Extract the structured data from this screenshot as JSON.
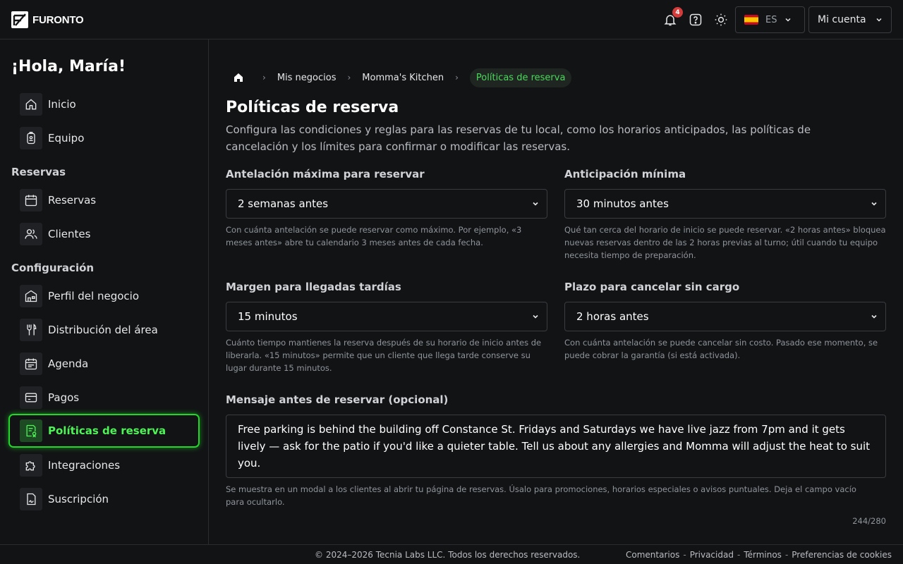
{
  "header": {
    "brand": "FURONTO",
    "notifications_count": "4",
    "language": "ES",
    "account_label": "Mi cuenta"
  },
  "sidebar": {
    "greeting": "¡Hola, María!",
    "items_top": [
      {
        "label": "Inicio",
        "icon": "home-icon"
      },
      {
        "label": "Equipo",
        "icon": "badge-icon"
      }
    ],
    "section_reservas": "Reservas",
    "items_reservas": [
      {
        "label": "Reservas",
        "icon": "calendar-icon"
      },
      {
        "label": "Clientes",
        "icon": "users-icon"
      }
    ],
    "section_config": "Configuración",
    "items_config": [
      {
        "label": "Perfil del negocio",
        "icon": "store-icon"
      },
      {
        "label": "Distribución del área",
        "icon": "cutlery-icon"
      },
      {
        "label": "Agenda",
        "icon": "agenda-icon"
      },
      {
        "label": "Pagos",
        "icon": "card-icon"
      },
      {
        "label": "Políticas de reserva",
        "icon": "policy-icon",
        "active": true
      },
      {
        "label": "Integraciones",
        "icon": "puzzle-icon"
      },
      {
        "label": "Suscripción",
        "icon": "signature-icon"
      }
    ]
  },
  "breadcrumb": {
    "items": [
      "Mis negocios",
      "Momma's Kitchen"
    ],
    "current": "Políticas de reserva"
  },
  "page": {
    "title": "Políticas de reserva",
    "description": "Configura las condiciones y reglas para las reservas de tu local, como los horarios anticipados, las políticas de cancelación y los límites para confirmar o modificar las reservas."
  },
  "fields": {
    "max_advance": {
      "label": "Antelación máxima para reservar",
      "value": "2 semanas antes",
      "help": "Con cuánta antelación se puede reservar como máximo. Por ejemplo, «3 meses antes» abre tu calendario 3 meses antes de cada fecha."
    },
    "min_advance": {
      "label": "Anticipación mínima",
      "value": "30 minutos antes",
      "help": "Qué tan cerca del horario de inicio se puede reservar. «2 horas antes» bloquea nuevas reservas dentro de las 2 horas previas al turno; útil cuando tu equipo necesita tiempo de preparación."
    },
    "late_margin": {
      "label": "Margen para llegadas tardías",
      "value": "15 minutos",
      "help": "Cuánto tiempo mantienes la reserva después de su horario de inicio antes de liberarla. «15 minutos» permite que un cliente que llega tarde conserve su lugar durante 15 minutos."
    },
    "cancel_deadline": {
      "label": "Plazo para cancelar sin cargo",
      "value": "2 horas antes",
      "help": "Con cuánta antelación se puede cancelar sin costo. Pasado ese momento, se puede cobrar la garantía (si está activada)."
    },
    "message": {
      "label": "Mensaje antes de reservar (opcional)",
      "value": "Free parking is behind the building off Constance St. Fridays and Saturdays we have live jazz from 7pm and it gets lively — ask for the patio if you'd like a quieter table. Tell us about any allergies and Momma will adjust the heat to suit you.",
      "help": "Se muestra en un modal a los clientes al abrir tu página de reservas. Úsalo para promociones, horarios especiales o avisos puntuales. Deja el campo vacío para ocultarlo.",
      "counter": "244/280"
    }
  },
  "footer": {
    "copyright": "© 2024–2026 Tecnia Labs LLC. Todos los derechos reservados.",
    "links": [
      "Comentarios",
      "Privacidad",
      "Términos",
      "Preferencias de cookies"
    ],
    "separator": "-"
  },
  "colors": {
    "accent": "#22d72a",
    "background": "#121315",
    "badge": "#d43b3b"
  }
}
